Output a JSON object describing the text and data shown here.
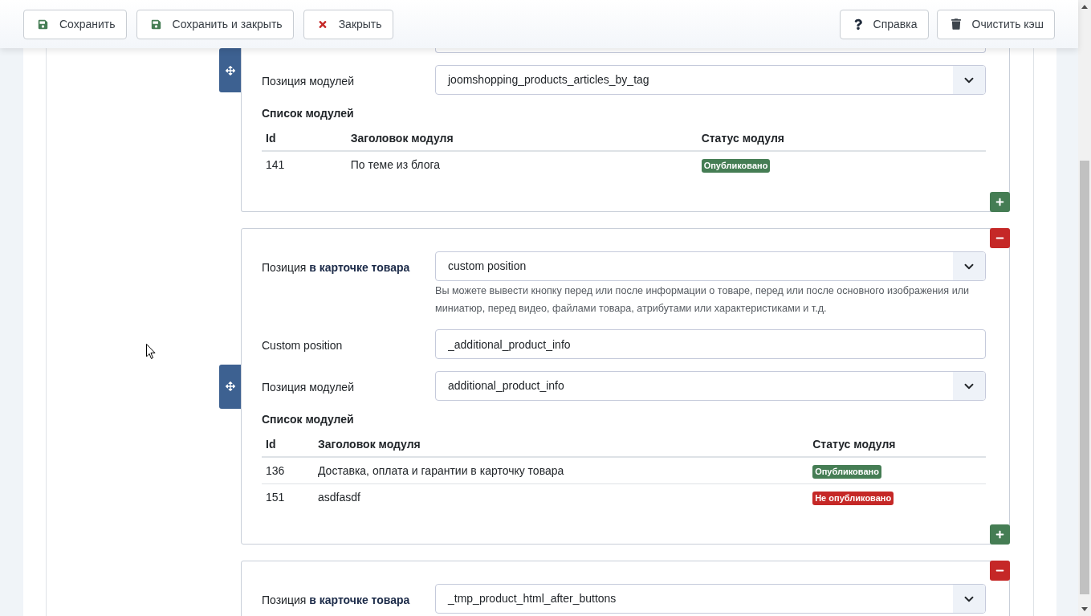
{
  "toolbar": {
    "left_buttons": [
      {
        "kind": "save",
        "label": "Сохранить"
      },
      {
        "kind": "save_close",
        "label": "Сохранить и закрыть"
      },
      {
        "kind": "close",
        "label": "Закрыть"
      }
    ],
    "right_buttons": [
      {
        "kind": "help",
        "label": "Справка"
      },
      {
        "kind": "clear_cache",
        "label": "Очистить кэш"
      }
    ]
  },
  "cards": [
    {
      "remove_button": false,
      "add_button": true,
      "fields": [
        {
          "kind": "clipped"
        },
        {
          "kind": "select",
          "label": "Позиция модулей",
          "value": "joomshopping_products_articles_by_tag"
        }
      ],
      "modules": {
        "title": "Список модулей",
        "columns": [
          "Id",
          "Заголовок модуля",
          "Статус модуля"
        ],
        "rows": [
          {
            "id": "141",
            "title": "По теме из блога",
            "status": "Опубликовано",
            "color": "#457d54"
          }
        ]
      }
    },
    {
      "remove_button": true,
      "add_button": true,
      "fields": [
        {
          "kind": "select",
          "label": "Позиция **в карточке товара**",
          "value": "custom position",
          "help": "Вы можете вывести кнопку перед или после информации о товаре, перед или после основного изображения или миниатюр, перед видео, файлами товара, атрибутами или характеристиками и т.д."
        },
        {
          "kind": "text",
          "label": "Custom position",
          "value": "_additional_product_info"
        },
        {
          "kind": "select",
          "label": "Позиция модулей",
          "value": "additional_product_info"
        }
      ],
      "modules": {
        "title": "Список модулей",
        "columns": [
          "Id",
          "Заголовок модуля",
          "Статус модуля"
        ],
        "rows": [
          {
            "id": "136",
            "title": "Доставка, оплата и гарантии в карточку товара",
            "status": "Опубликовано",
            "color": "#457d54"
          },
          {
            "id": "151",
            "title": "asdfasdf",
            "status": "Не опубликовано",
            "color": "#c52827"
          }
        ]
      }
    },
    {
      "remove_button": true,
      "add_button": false,
      "fields": [
        {
          "kind": "select",
          "label": "Позиция **в карточке товара**",
          "value": "_tmp_product_html_after_buttons"
        }
      ]
    }
  ]
}
